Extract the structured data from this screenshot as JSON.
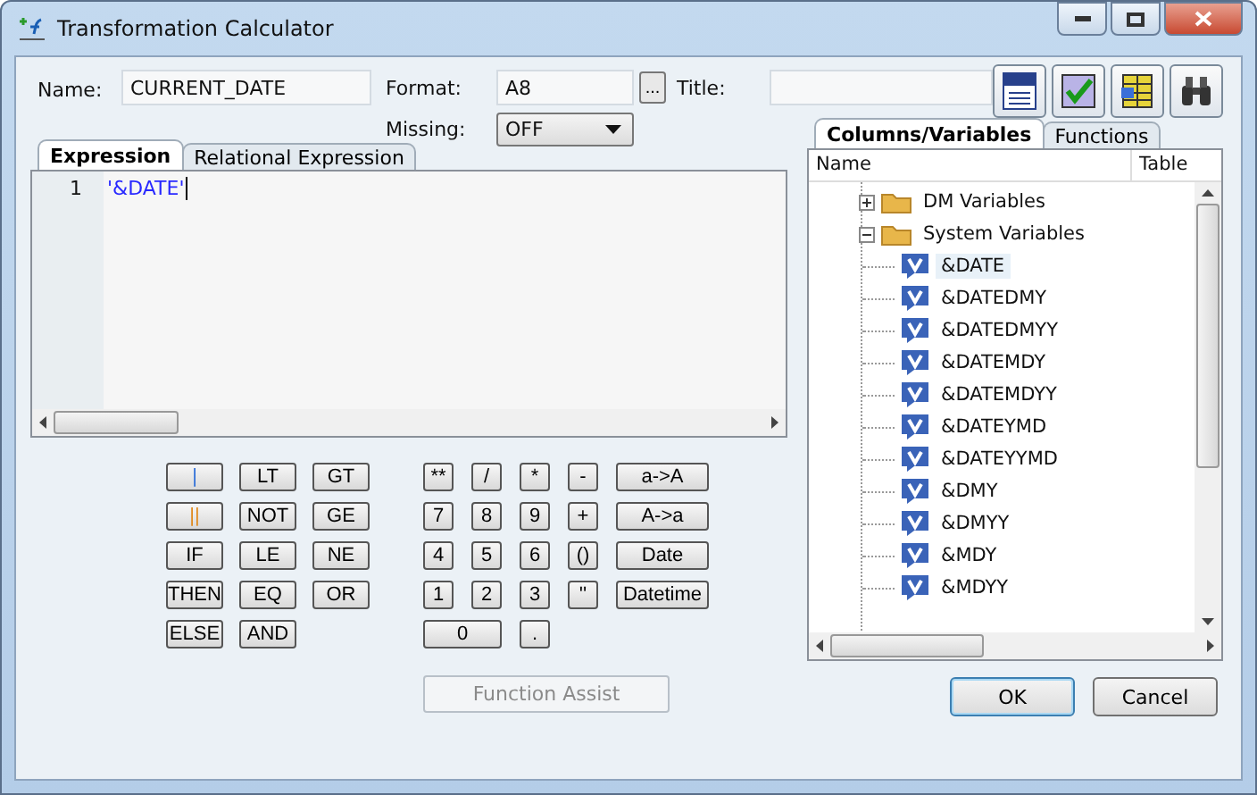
{
  "window": {
    "title": "Transformation Calculator"
  },
  "name": {
    "label": "Name:",
    "value": "CURRENT_DATE"
  },
  "format": {
    "label": "Format:",
    "value": "A8",
    "browse": "..."
  },
  "title_field": {
    "label": "Title:"
  },
  "missing": {
    "label": "Missing:",
    "value": "OFF"
  },
  "editor_tabs": [
    {
      "label": "Expression",
      "selected": true
    },
    {
      "label": "Relational Expression",
      "selected": false
    }
  ],
  "editor": {
    "lines": [
      {
        "number": "1",
        "text": "'&DATE'"
      }
    ]
  },
  "logic_keys": [
    {
      "label": "|",
      "color": "#2f6fd8"
    },
    {
      "label": "LT"
    },
    {
      "label": "GT"
    },
    {
      "label": "||",
      "color": "#e08a1e"
    },
    {
      "label": "NOT"
    },
    {
      "label": "GE"
    },
    {
      "label": "IF"
    },
    {
      "label": "LE"
    },
    {
      "label": "NE"
    },
    {
      "label": "THEN"
    },
    {
      "label": "EQ"
    },
    {
      "label": "OR"
    },
    {
      "label": "ELSE"
    },
    {
      "label": "AND"
    }
  ],
  "math_keys": [
    {
      "label": "**",
      "kind": "small"
    },
    {
      "label": "/",
      "kind": "small"
    },
    {
      "label": "*",
      "kind": "small"
    },
    {
      "label": "-",
      "kind": "small"
    },
    {
      "label": "a->A",
      "kind": "wide"
    },
    {
      "label": "7",
      "kind": "small"
    },
    {
      "label": "8",
      "kind": "small"
    },
    {
      "label": "9",
      "kind": "small"
    },
    {
      "label": "+",
      "kind": "small"
    },
    {
      "label": "A->a",
      "kind": "wide"
    },
    {
      "label": "4",
      "kind": "small"
    },
    {
      "label": "5",
      "kind": "small"
    },
    {
      "label": "6",
      "kind": "small"
    },
    {
      "label": "()",
      "kind": "small"
    },
    {
      "label": "Date",
      "kind": "wide"
    },
    {
      "label": "1",
      "kind": "small"
    },
    {
      "label": "2",
      "kind": "small"
    },
    {
      "label": "3",
      "kind": "small"
    },
    {
      "label": "''",
      "kind": "small"
    },
    {
      "label": "Datetime",
      "kind": "wide"
    },
    {
      "label": "0",
      "kind": "double"
    },
    {
      "label": ".",
      "kind": "small"
    }
  ],
  "function_assist": {
    "label": "Function Assist",
    "disabled": true
  },
  "side_tabs": [
    {
      "label": "Columns/Variables",
      "selected": true
    },
    {
      "label": "Functions",
      "selected": false
    }
  ],
  "tree": {
    "columns": [
      "Name",
      "Table"
    ],
    "items": [
      {
        "label": "DM Variables",
        "expanded": false,
        "selected": false
      },
      {
        "label": "System Variables",
        "expanded": true,
        "selected": false,
        "children": [
          {
            "label": "&DATE",
            "selected": true
          },
          {
            "label": "&DATEDMY",
            "selected": false
          },
          {
            "label": "&DATEDMYY",
            "selected": false
          },
          {
            "label": "&DATEMDY",
            "selected": false
          },
          {
            "label": "&DATEMDYY",
            "selected": false
          },
          {
            "label": "&DATEYMD",
            "selected": false
          },
          {
            "label": "&DATEYYMD",
            "selected": false
          },
          {
            "label": "&DMY",
            "selected": false
          },
          {
            "label": "&DMYY",
            "selected": false
          },
          {
            "label": "&MDY",
            "selected": false
          },
          {
            "label": "&MDYY",
            "selected": false
          }
        ]
      }
    ]
  },
  "buttons": [
    {
      "label": "OK",
      "default": true
    },
    {
      "label": "Cancel",
      "default": false
    }
  ]
}
